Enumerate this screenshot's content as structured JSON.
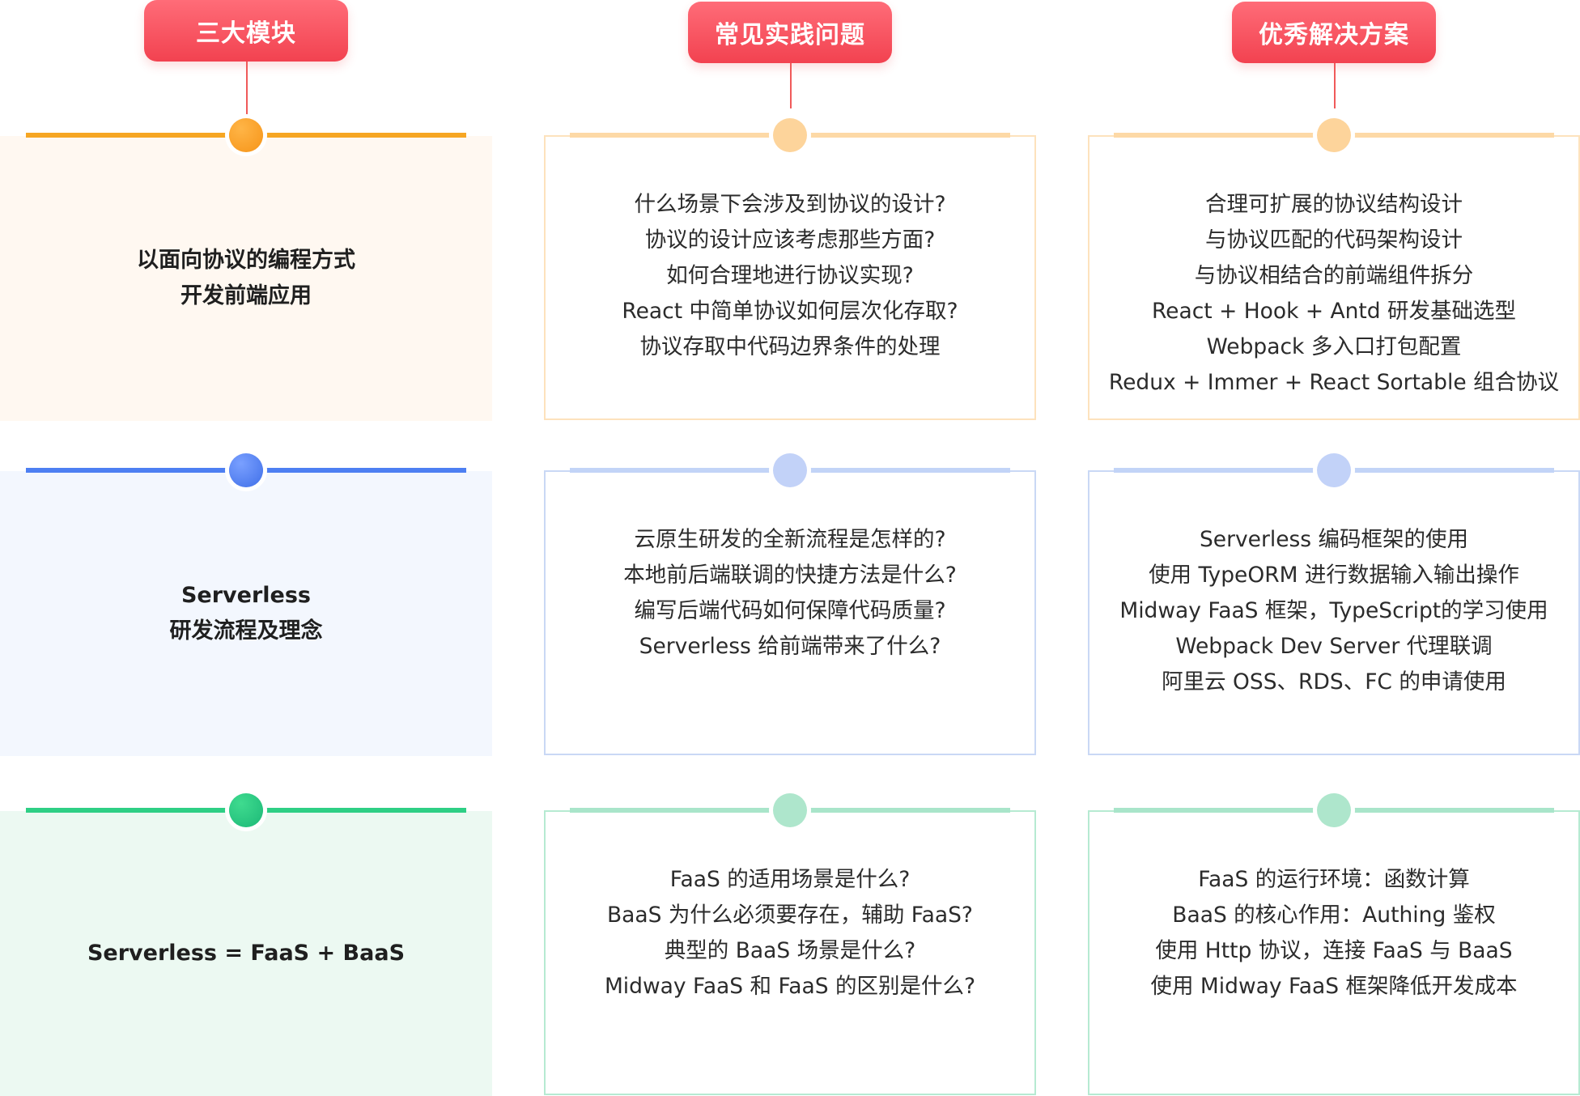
{
  "headers": {
    "col1": "三大模块",
    "col2": "常见实践问题",
    "col3": "优秀解决方案"
  },
  "rows": [
    {
      "module": [
        "以面向协议的编程方式",
        "开发前端应用"
      ],
      "questions": [
        "什么场景下会涉及到协议的设计?",
        "协议的设计应该考虑那些方面?",
        "如何合理地进行协议实现?",
        "React 中简单协议如何层次化存取?",
        "协议存取中代码边界条件的处理"
      ],
      "solutions": [
        "合理可扩展的协议结构设计",
        "与协议匹配的代码架构设计",
        "与协议相结合的前端组件拆分",
        "React + Hook + Antd 研发基础选型",
        "Webpack 多入口打包配置",
        "Redux + Immer + React Sortable 组合协议"
      ]
    },
    {
      "module": [
        "Serverless",
        "研发流程及理念"
      ],
      "questions": [
        "云原生研发的全新流程是怎样的?",
        "本地前后端联调的快捷方法是什么?",
        "编写后端代码如何保障代码质量?",
        "Serverless 给前端带来了什么?"
      ],
      "solutions": [
        "Serverless 编码框架的使用",
        "使用 TypeORM 进行数据输入输出操作",
        "Midway FaaS 框架，TypeScript的学习使用",
        "Webpack Dev Server 代理联调",
        "阿里云 OSS、RDS、FC 的申请使用"
      ]
    },
    {
      "module": [
        "Serverless = FaaS + BaaS"
      ],
      "questions": [
        "FaaS 的适用场景是什么?",
        "BaaS 为什么必须要存在，辅助 FaaS?",
        "典型的 BaaS 场景是什么?",
        "Midway FaaS 和 FaaS 的区别是什么?"
      ],
      "solutions": [
        "FaaS 的运行环境：函数计算",
        "BaaS 的核心作用：Authing 鉴权",
        "使用 Http 协议，连接 FaaS 与 BaaS",
        "使用 Midway FaaS 框架降低开发成本"
      ]
    }
  ],
  "colors": {
    "header": "#f24250",
    "row1_accent": "#f6a623",
    "row1_light": "#fdd9a6",
    "row1_bg": "#fff8f1",
    "row2_accent": "#4d7ff2",
    "row2_light": "#c2d4f7",
    "row2_bg": "#f3f7fe",
    "row3_accent": "#2ecf85",
    "row3_light": "#a9e5ca",
    "row3_bg": "#ecf9f2"
  }
}
